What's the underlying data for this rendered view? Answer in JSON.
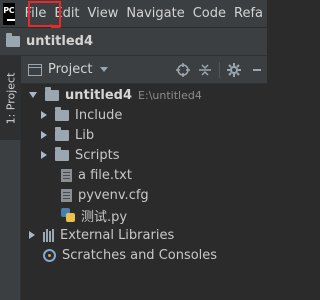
{
  "app": {
    "logo_text": "PC"
  },
  "menu": {
    "items": [
      "File",
      "Edit",
      "View",
      "Navigate",
      "Code",
      "Refa"
    ]
  },
  "navbar": {
    "project_name": "untitled4"
  },
  "side_stripe": {
    "tab_label": "1: Project"
  },
  "panel": {
    "view_label": "Project",
    "tools": [
      "crosshair-icon",
      "collapse-icon",
      "gear-icon",
      "hide-icon"
    ]
  },
  "tree": {
    "root": {
      "name": "untitled4",
      "path": "E:\\untitled4"
    },
    "children": [
      {
        "name": "Include",
        "type": "folder",
        "expanded": false
      },
      {
        "name": "Lib",
        "type": "folder",
        "expanded": false
      },
      {
        "name": "Scripts",
        "type": "folder",
        "expanded": false
      },
      {
        "name": "a file.txt",
        "type": "file"
      },
      {
        "name": "pyvenv.cfg",
        "type": "file"
      },
      {
        "name": "测试.py",
        "type": "python"
      }
    ],
    "external_libraries": "External Libraries",
    "scratches": "Scratches and Consoles"
  },
  "colors": {
    "highlight": "#e52b2b",
    "background": "#2b2b2b",
    "toolbar": "#3c3f41"
  }
}
